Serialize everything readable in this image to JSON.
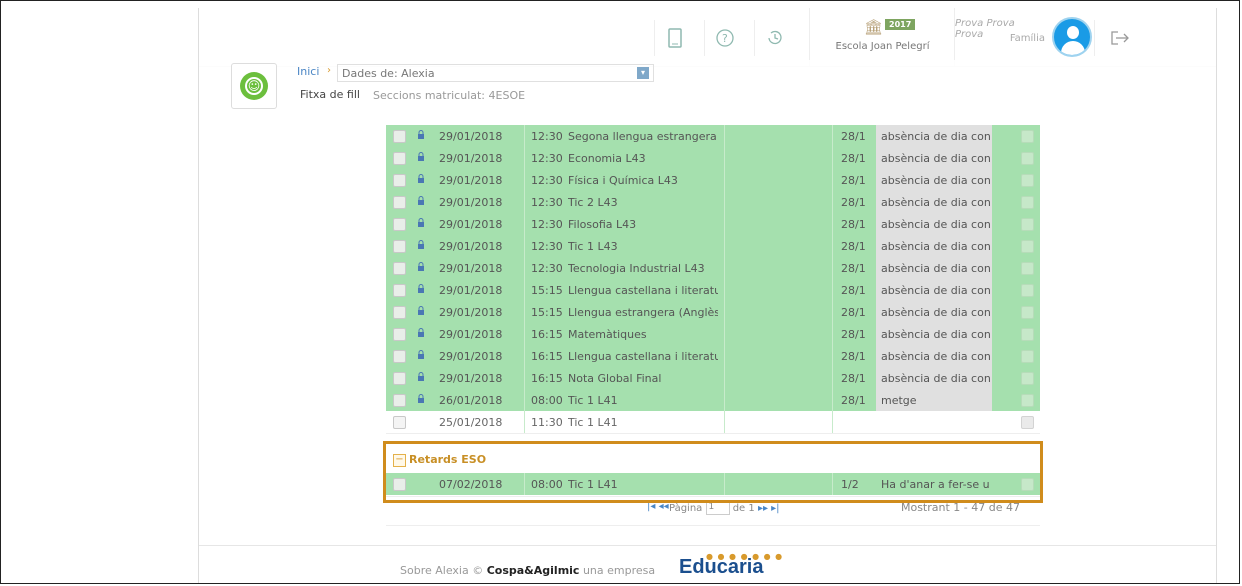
{
  "header": {
    "school_name": "Escola Joan Pelegrí",
    "year_badge": "2017",
    "user_name": "Prova Prova Prova",
    "user_role": "Família",
    "icons": [
      "tablet-icon",
      "help-icon",
      "history-icon",
      "bank-icon",
      "user-avatar",
      "logout-icon"
    ]
  },
  "breadcrumb": {
    "home": "Inici",
    "selector": "Dades de: Alexia",
    "title": "Fitxa de fill",
    "sections": "Seccions matriculat: 4ESOE"
  },
  "rows": [
    {
      "date": "29/01/2018",
      "time": "12:30",
      "subject": "Segona llengua estrangera:",
      "day": "28/1",
      "reason": "absència de dia con"
    },
    {
      "date": "29/01/2018",
      "time": "12:30",
      "subject": "Economia L43",
      "day": "28/1",
      "reason": "absència de dia con"
    },
    {
      "date": "29/01/2018",
      "time": "12:30",
      "subject": "Física i Química L43",
      "day": "28/1",
      "reason": "absència de dia con"
    },
    {
      "date": "29/01/2018",
      "time": "12:30",
      "subject": "Tic 2 L43",
      "day": "28/1",
      "reason": "absència de dia con"
    },
    {
      "date": "29/01/2018",
      "time": "12:30",
      "subject": "Filosofia L43",
      "day": "28/1",
      "reason": "absència de dia con"
    },
    {
      "date": "29/01/2018",
      "time": "12:30",
      "subject": "Tic 1 L43",
      "day": "28/1",
      "reason": "absència de dia con"
    },
    {
      "date": "29/01/2018",
      "time": "12:30",
      "subject": "Tecnologia Industrial L43",
      "day": "28/1",
      "reason": "absència de dia con"
    },
    {
      "date": "29/01/2018",
      "time": "15:15",
      "subject": "Llengua castellana i literatu",
      "day": "28/1",
      "reason": "absència de dia con"
    },
    {
      "date": "29/01/2018",
      "time": "15:15",
      "subject": "Llengua estrangera (Anglès)",
      "day": "28/1",
      "reason": "absència de dia con"
    },
    {
      "date": "29/01/2018",
      "time": "16:15",
      "subject": "Matemàtiques",
      "day": "28/1",
      "reason": "absència de dia con"
    },
    {
      "date": "29/01/2018",
      "time": "16:15",
      "subject": "Llengua castellana i literatu",
      "day": "28/1",
      "reason": "absència de dia con"
    },
    {
      "date": "29/01/2018",
      "time": "16:15",
      "subject": "Nota Global Final",
      "day": "28/1",
      "reason": "absència de dia con"
    },
    {
      "date": "26/01/2018",
      "time": "08:00",
      "subject": "Tic 1 L41",
      "day": "28/1",
      "reason": "metge"
    },
    {
      "date": "25/01/2018",
      "time": "11:30",
      "subject": "Tic 1 L41",
      "day": "",
      "reason": ""
    }
  ],
  "group": {
    "label": "Retards ESO"
  },
  "group_row": {
    "date": "07/02/2018",
    "time": "08:00",
    "subject": "Tic 1 L41",
    "day": "1/2",
    "reason": "Ha d'anar a fer-se u"
  },
  "pager": {
    "page_label": "Pàgina",
    "page": "1",
    "of_label": "de",
    "total_pages": "1",
    "count": "Mostrant 1 - 47 de 47"
  },
  "footer": {
    "about": "Sobre Alexia ©",
    "company": "Cospa&Agilmic",
    "suffix": "una empresa",
    "brand": "Educaria"
  },
  "colors": {
    "row_green": "#a5e0ae",
    "highlight": "#d08c1c",
    "link": "#4a86c5"
  }
}
